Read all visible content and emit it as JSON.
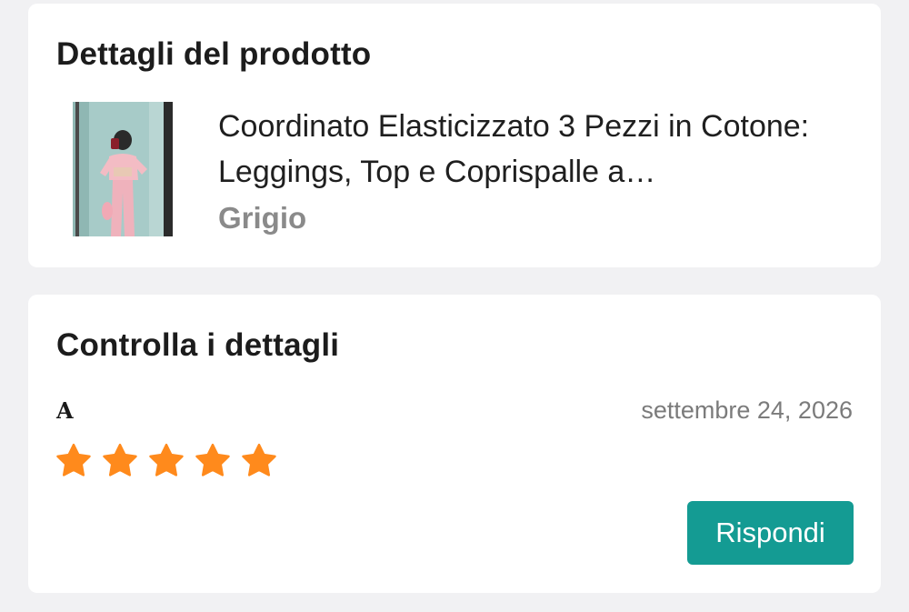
{
  "product_card": {
    "title": "Dettagli del prodotto",
    "product_name": "Coordinato Elasticizzato 3 Pezzi in Cotone: Leggings, Top e Coprispalle a…",
    "variant": "Grigio",
    "image_icon": "product-photo"
  },
  "review_card": {
    "title": "Controlla i dettagli",
    "reviewer_initial": "A",
    "date": "settembre 24, 2026",
    "rating": 5,
    "rating_max": 5,
    "star_color": "#ff8a1c",
    "reply_label": "Rispondi",
    "reply_color": "#149b93"
  }
}
